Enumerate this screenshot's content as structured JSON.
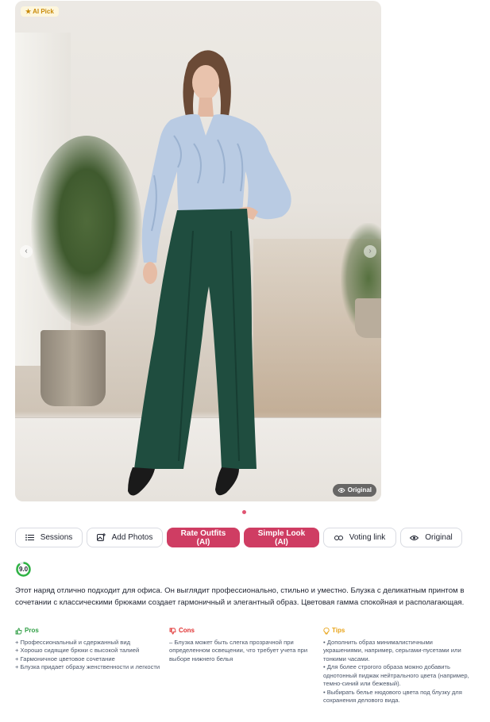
{
  "photo": {
    "badge_label": "AI Pick",
    "original_label": "Original",
    "prev_glyph": "‹",
    "next_glyph": "›",
    "slides_total": 1,
    "slide_active": 1
  },
  "toolbar": {
    "sessions": "Sessions",
    "add_photos": "Add Photos",
    "rate_outfits": "Rate Outfits (AI)",
    "simple_look": "Simple Look (AI)",
    "voting_link": "Voting link",
    "original": "Original"
  },
  "score": {
    "value": "9.0",
    "fraction": 0.9
  },
  "summary": "Этот наряд отлично подходит для офиса. Он выглядит профессионально, стильно и уместно. Блузка с деликатным принтом в сочетании с классическими брюками создает гармоничный и элегантный образ. Цветовая гамма спокойная и располагающая.",
  "pros": {
    "title": "Pros",
    "items": [
      "+ Профессиональный и сдержанный вид",
      "+ Хорошо сидящие брюки с высокой талией",
      "+ Гармоничное цветовое сочетание",
      "+ Блузка придает образу женственности и легкости"
    ]
  },
  "cons": {
    "title": "Cons",
    "items": [
      "– Блузка может быть слегка прозрачной при определенном освещении, что требует учета при выборе нижнего белья"
    ]
  },
  "tips": {
    "title": "Tips",
    "items": [
      "• Дополнить образ минималистичными украшениями, например, серьгами-пусетами или тонкими часами.",
      "• Для более строгого образа можно добавить однотонный пиджак нейтрального цвета (например, темно-синий или бежевый).",
      "• Выбирать белье нюдового цвета под блузку для сохранения делового вида."
    ]
  },
  "colors": {
    "accent": "#cf3d63",
    "pros": "#2f9e44",
    "cons": "#e03131",
    "tips": "#e8a317",
    "score_ring": "#2fb344"
  }
}
